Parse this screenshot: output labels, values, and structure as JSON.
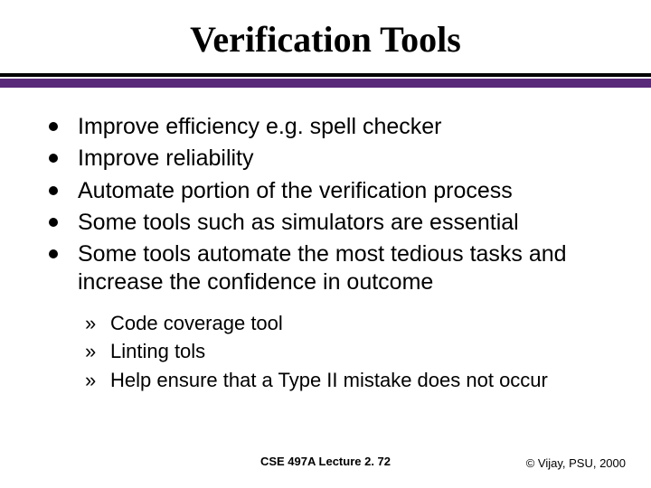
{
  "title": "Verification Tools",
  "bullets": [
    "Improve efficiency e.g. spell checker",
    "Improve reliability",
    "Automate portion of the verification process",
    "Some tools such as simulators are essential",
    "Some tools automate the most tedious tasks and increase the confidence in outcome"
  ],
  "sub_bullets": [
    "Code coverage tool",
    "Linting tols",
    "Help ensure that a Type II mistake does not occur"
  ],
  "footer": {
    "center": "CSE 497A Lecture 2. 72",
    "right": "© Vijay, PSU, 2000"
  }
}
